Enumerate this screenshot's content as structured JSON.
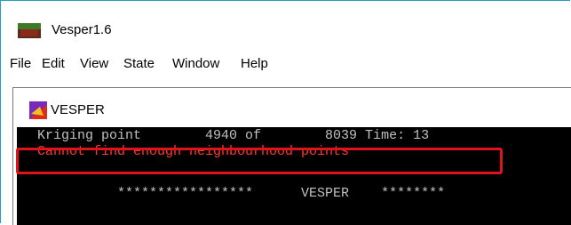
{
  "window": {
    "title": "Vesper1.6",
    "icon": "vesper-app-icon"
  },
  "menu": [
    "File",
    "Edit",
    "View",
    "State",
    "Window",
    "Help"
  ],
  "child_window": {
    "title": "VESPER",
    "icon": "vesper-window-icon"
  },
  "console": {
    "line1": "Kriging point        4940 of        8039 Time: 13",
    "line2": "Cannot find enough neighbourhood points",
    "line3": "          *****************      VESPER    ********"
  },
  "colors": {
    "border_accent": "#21a0bf",
    "console_bg": "#000000",
    "console_text": "#c0c0c0",
    "error_text": "#ff3b2f",
    "highlight": "#e0121c"
  }
}
